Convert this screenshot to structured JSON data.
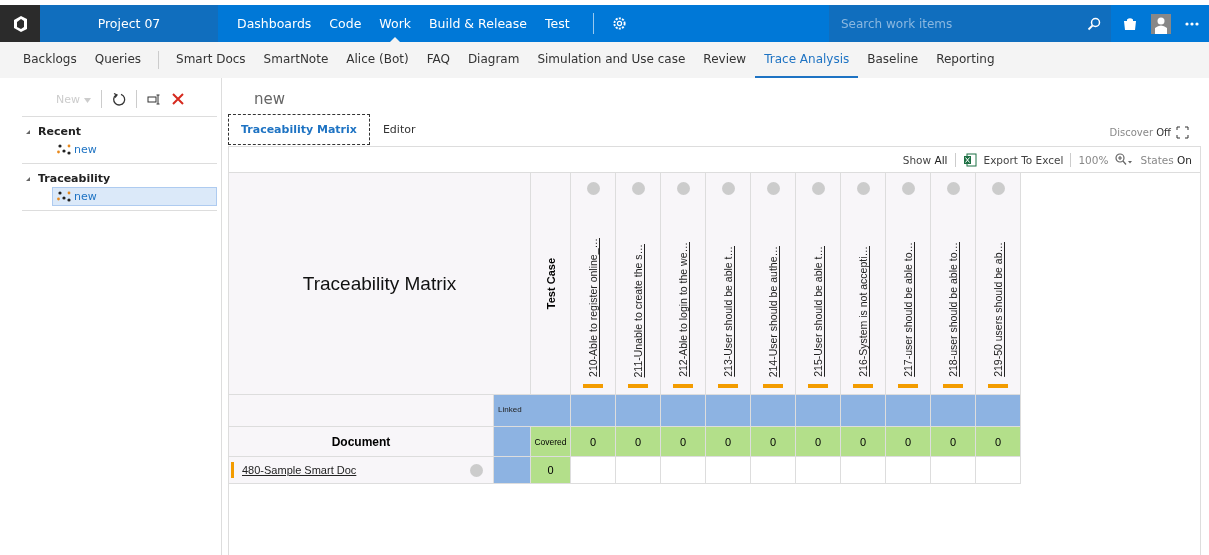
{
  "header": {
    "project": "Project 07",
    "nav": [
      {
        "label": "Dashboards",
        "selected": false
      },
      {
        "label": "Code",
        "selected": false
      },
      {
        "label": "Work",
        "selected": true
      },
      {
        "label": "Build & Release",
        "selected": false
      },
      {
        "label": "Test",
        "selected": false
      }
    ],
    "search": {
      "placeholder": "Search work items"
    }
  },
  "subnav": {
    "primary": [
      {
        "label": "Backlogs",
        "selected": false
      },
      {
        "label": "Queries",
        "selected": false
      }
    ],
    "secondary": [
      {
        "label": "Smart Docs",
        "selected": false
      },
      {
        "label": "SmartNote",
        "selected": false
      },
      {
        "label": "Alice (Bot)",
        "selected": false
      },
      {
        "label": "FAQ",
        "selected": false
      },
      {
        "label": "Diagram",
        "selected": false
      },
      {
        "label": "Simulation and Use case",
        "selected": false
      },
      {
        "label": "Review",
        "selected": false
      },
      {
        "label": "Trace Analysis",
        "selected": true
      },
      {
        "label": "Baseline",
        "selected": false
      },
      {
        "label": "Reporting",
        "selected": false
      }
    ]
  },
  "toolbar": {
    "new_button": {
      "label": "New",
      "disabled": true
    }
  },
  "tree": [
    {
      "label": "Recent",
      "expanded": true,
      "children": [
        {
          "label": "new",
          "selected": false
        }
      ]
    },
    {
      "label": "Traceability",
      "expanded": true,
      "children": [
        {
          "label": "new",
          "selected": true
        }
      ]
    }
  ],
  "page_title": "new",
  "tabs": [
    {
      "label": "Traceability Matrix",
      "selected": true
    },
    {
      "label": "Editor",
      "selected": false
    }
  ],
  "discover": {
    "label": "Discover",
    "value": "Off"
  },
  "matrix_toolbar": {
    "show_label": "Show",
    "show_value": "All",
    "export": "Export To Excel",
    "zoom": "100%",
    "states_label": "States",
    "states_value": "On"
  },
  "matrix": {
    "title": "Traceability Matrix",
    "column_type": "Test Case",
    "linked_label": "Linked",
    "row_type": "Document",
    "covered_label": "Covered",
    "columns": [
      "210-Able to register online_…",
      "211-Unable to create the s…",
      "212-Able to login to the we…",
      "213-User should be able t…",
      "214-User should be authe…",
      "215-User should be able t…",
      "216-System is not accepti…",
      "217-user should be able to…",
      "218-user should be able to…",
      "219-50 users should be ab…"
    ],
    "covered": [
      "0",
      "0",
      "0",
      "0",
      "0",
      "0",
      "0",
      "0",
      "0",
      "0"
    ],
    "rows": [
      {
        "label": "480-Sample Smart Doc",
        "count": "0"
      }
    ]
  }
}
